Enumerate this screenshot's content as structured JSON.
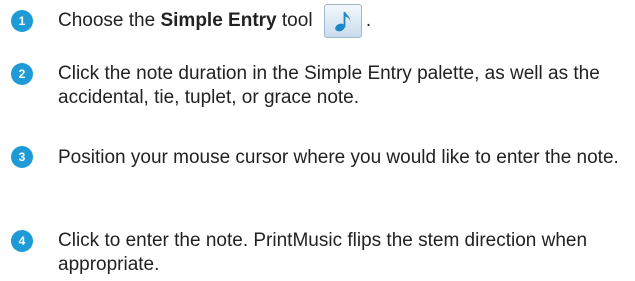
{
  "colors": {
    "badge": "#1e9bd7",
    "text": "#222222",
    "icon_bg": "#dbe9f4",
    "icon_note": "#1c86c8"
  },
  "steps": [
    {
      "number": "1",
      "prefix": "Choose the ",
      "bold": "Simple Entry",
      "suffix": " tool",
      "icon": "eighth-note-icon",
      "end": "."
    },
    {
      "number": "2",
      "text": "Click the note duration in the Simple Entry palette, as well as the accidental, tie, tuplet, or grace note."
    },
    {
      "number": "3",
      "text": "Position your mouse cursor where you would like to enter the note."
    },
    {
      "number": "4",
      "text": "Click to enter the note. PrintMusic flips the stem direction when appropriate."
    }
  ]
}
